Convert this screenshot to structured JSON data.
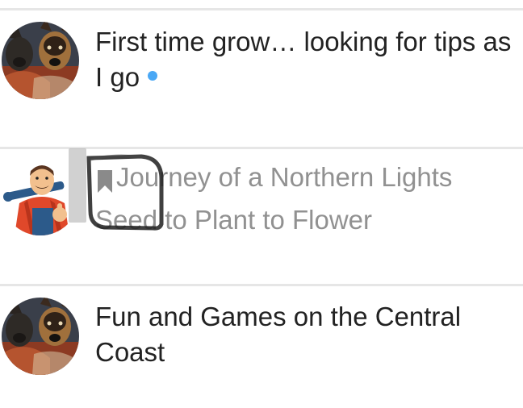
{
  "topics": [
    {
      "title": "First time grow… looking for tips as I go",
      "unread": true,
      "bookmarked": false,
      "read": false,
      "avatar_icon": "dog-avatar-icon"
    },
    {
      "title": "Journey of a Northern Lights Seed to Plant to Flower",
      "unread": false,
      "bookmarked": true,
      "read": true,
      "avatar_icon": "plumber-avatar-icon"
    },
    {
      "title": "Fun and Games on the Central Coast",
      "unread": false,
      "bookmarked": false,
      "read": false,
      "avatar_icon": "dog-avatar-icon"
    }
  ],
  "colors": {
    "unread_dot": "#4aa8f5",
    "title_text": "#222222",
    "read_title_text": "#919191",
    "bookmark": "#8a8a8a",
    "divider": "#e6e6e6"
  }
}
